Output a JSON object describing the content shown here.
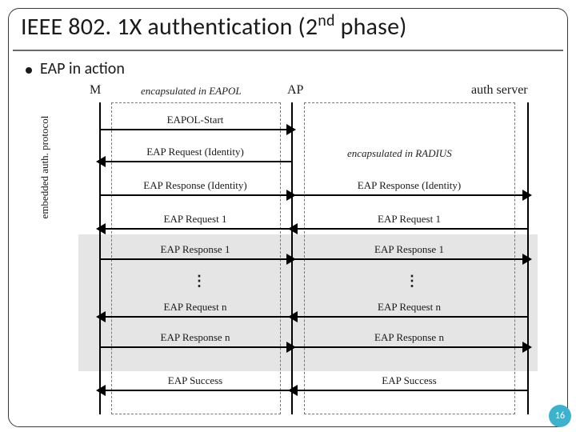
{
  "title": {
    "prefix": "IEEE 802. 1X authentication (2",
    "sup": "nd",
    "suffix": " phase)"
  },
  "subtitle": "EAP in action",
  "entities": {
    "m": "M",
    "ap": "AP",
    "as": "auth server"
  },
  "captions": {
    "left": "encapsulated in EAPOL",
    "right_initial": "encapsulated in RADIUS"
  },
  "vertical_label": "embedded auth. protocol",
  "messages": {
    "eapol_start": "EAPOL-Start",
    "req_identity": "EAP Request (Identity)",
    "resp_identity_l": "EAP Response (Identity)",
    "resp_identity_r": "EAP Response (Identity)",
    "req1_l": "EAP Request 1",
    "req1_r": "EAP Request 1",
    "resp1_l": "EAP Response 1",
    "resp1_r": "EAP Response 1",
    "reqn_l": "EAP Request n",
    "reqn_r": "EAP Request n",
    "respn_l": "EAP Response n",
    "respn_r": "EAP Response n",
    "success_l": "EAP Success",
    "success_r": "EAP Success"
  },
  "page_number": "16"
}
